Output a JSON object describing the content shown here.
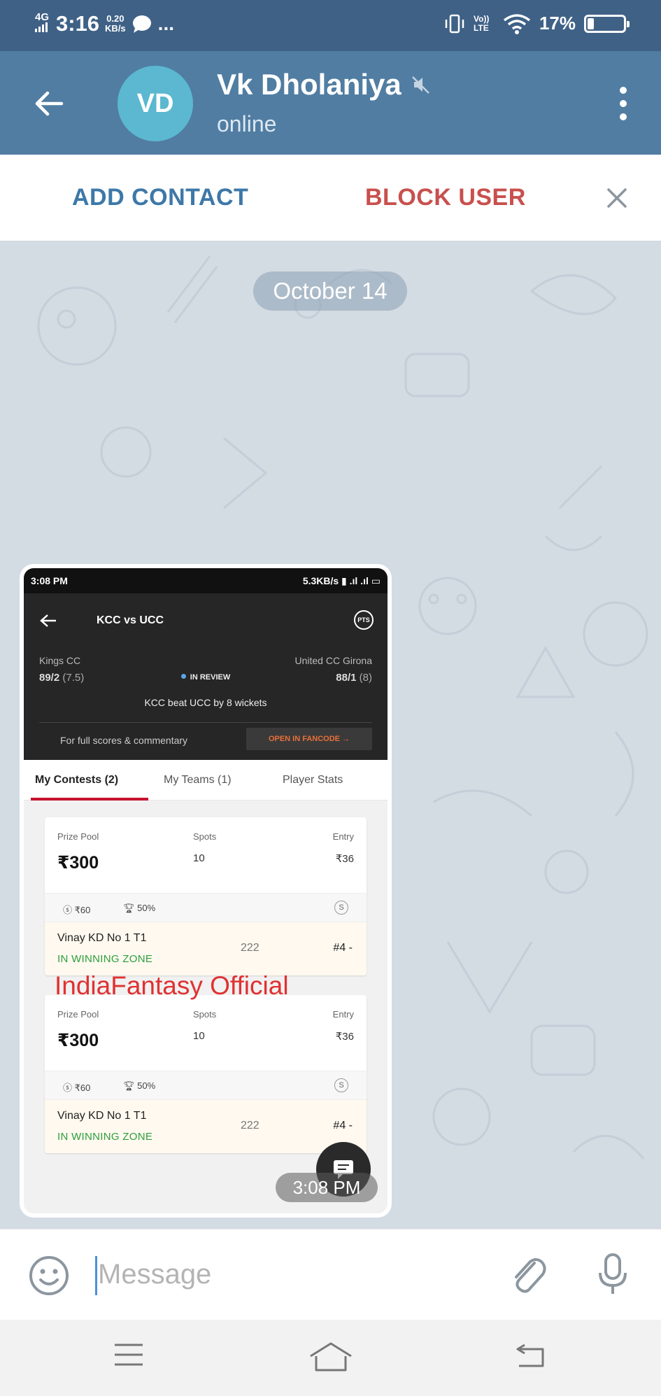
{
  "status_bar": {
    "network": "4G",
    "time": "3:16",
    "speed_value": "0.20",
    "speed_unit": "KB/s",
    "dots": "...",
    "volte": "Vo)) LTE",
    "battery_percent": "17%",
    "battery_level": 0.17
  },
  "header": {
    "avatar_initials": "VD",
    "contact_name": "Vk Dholaniya",
    "contact_status": "online"
  },
  "action_bar": {
    "add_contact": "ADD CONTACT",
    "block_user": "BLOCK USER"
  },
  "chat": {
    "date_label": "October 14",
    "message_time": "3:08 PM",
    "screenshot": {
      "status_time": "3:08 PM",
      "status_right": "5.3KB/s",
      "match_title": "KCC vs UCC",
      "pts_badge": "PTS",
      "team_left": "Kings CC",
      "score_left": "89/2",
      "overs_left": "(7.5)",
      "review_status": "IN REVIEW",
      "team_right": "United CC Girona",
      "score_right": "88/1",
      "overs_right": "(8)",
      "result": "KCC beat UCC by 8 wickets",
      "full_scores_text": "For full scores & commentary",
      "open_button": "OPEN IN FANCODE →",
      "tabs": [
        "My Contests (2)",
        "My Teams (1)",
        "Player Stats"
      ],
      "cards": [
        {
          "prize_label": "Prize Pool",
          "prize": "₹300",
          "spots_label": "Spots",
          "spots": "10",
          "entry_label": "Entry",
          "entry": "₹36",
          "first_prize": "₹60",
          "winners": "50%",
          "badge": "S",
          "team_name": "Vinay KD No 1  T1",
          "zone": "IN WINNING ZONE",
          "points": "222",
          "rank": "#4  -"
        },
        {
          "prize_label": "Prize Pool",
          "prize": "₹300",
          "spots_label": "Spots",
          "spots": "10",
          "entry_label": "Entry",
          "entry": "₹36",
          "first_prize": "₹60",
          "winners": "50%",
          "badge": "S",
          "team_name": "Vinay KD No 1  T1",
          "zone": "IN WINNING ZONE",
          "points": "222",
          "rank": "#4  -"
        }
      ],
      "watermark": "IndiaFantasy Official"
    }
  },
  "input": {
    "placeholder": "Message"
  },
  "colors": {
    "header_bg": "#517da2",
    "statusbar_bg": "#3f6186",
    "add_contact": "#3d78a8",
    "block_user": "#c8504d",
    "avatar": "#5bb8d0",
    "winning_zone": "#2c9f3c"
  },
  "icons": [
    "back-arrow-icon",
    "mute-icon",
    "more-vertical-icon",
    "close-icon",
    "emoji-icon",
    "attach-icon",
    "mic-icon",
    "menu-icon",
    "home-icon",
    "back-nav-icon",
    "chat-bubble-icon"
  ]
}
